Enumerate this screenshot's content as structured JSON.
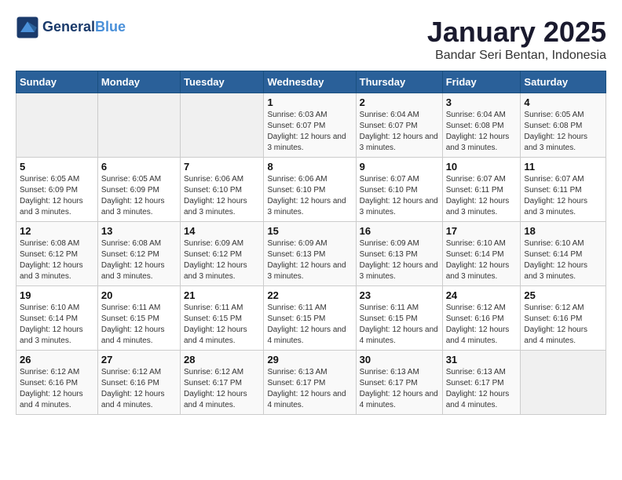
{
  "header": {
    "logo_line1": "General",
    "logo_line2": "Blue",
    "title": "January 2025",
    "subtitle": "Bandar Seri Bentan, Indonesia"
  },
  "weekdays": [
    "Sunday",
    "Monday",
    "Tuesday",
    "Wednesday",
    "Thursday",
    "Friday",
    "Saturday"
  ],
  "weeks": [
    [
      {
        "day": "",
        "empty": true
      },
      {
        "day": "",
        "empty": true
      },
      {
        "day": "",
        "empty": true
      },
      {
        "day": "1",
        "sunrise": "6:03 AM",
        "sunset": "6:07 PM",
        "daylight": "Daylight: 12 hours and 3 minutes."
      },
      {
        "day": "2",
        "sunrise": "6:04 AM",
        "sunset": "6:07 PM",
        "daylight": "Daylight: 12 hours and 3 minutes."
      },
      {
        "day": "3",
        "sunrise": "6:04 AM",
        "sunset": "6:08 PM",
        "daylight": "Daylight: 12 hours and 3 minutes."
      },
      {
        "day": "4",
        "sunrise": "6:05 AM",
        "sunset": "6:08 PM",
        "daylight": "Daylight: 12 hours and 3 minutes."
      }
    ],
    [
      {
        "day": "5",
        "sunrise": "6:05 AM",
        "sunset": "6:09 PM",
        "daylight": "Daylight: 12 hours and 3 minutes."
      },
      {
        "day": "6",
        "sunrise": "6:05 AM",
        "sunset": "6:09 PM",
        "daylight": "Daylight: 12 hours and 3 minutes."
      },
      {
        "day": "7",
        "sunrise": "6:06 AM",
        "sunset": "6:10 PM",
        "daylight": "Daylight: 12 hours and 3 minutes."
      },
      {
        "day": "8",
        "sunrise": "6:06 AM",
        "sunset": "6:10 PM",
        "daylight": "Daylight: 12 hours and 3 minutes."
      },
      {
        "day": "9",
        "sunrise": "6:07 AM",
        "sunset": "6:10 PM",
        "daylight": "Daylight: 12 hours and 3 minutes."
      },
      {
        "day": "10",
        "sunrise": "6:07 AM",
        "sunset": "6:11 PM",
        "daylight": "Daylight: 12 hours and 3 minutes."
      },
      {
        "day": "11",
        "sunrise": "6:07 AM",
        "sunset": "6:11 PM",
        "daylight": "Daylight: 12 hours and 3 minutes."
      }
    ],
    [
      {
        "day": "12",
        "sunrise": "6:08 AM",
        "sunset": "6:12 PM",
        "daylight": "Daylight: 12 hours and 3 minutes."
      },
      {
        "day": "13",
        "sunrise": "6:08 AM",
        "sunset": "6:12 PM",
        "daylight": "Daylight: 12 hours and 3 minutes."
      },
      {
        "day": "14",
        "sunrise": "6:09 AM",
        "sunset": "6:12 PM",
        "daylight": "Daylight: 12 hours and 3 minutes."
      },
      {
        "day": "15",
        "sunrise": "6:09 AM",
        "sunset": "6:13 PM",
        "daylight": "Daylight: 12 hours and 3 minutes."
      },
      {
        "day": "16",
        "sunrise": "6:09 AM",
        "sunset": "6:13 PM",
        "daylight": "Daylight: 12 hours and 3 minutes."
      },
      {
        "day": "17",
        "sunrise": "6:10 AM",
        "sunset": "6:14 PM",
        "daylight": "Daylight: 12 hours and 3 minutes."
      },
      {
        "day": "18",
        "sunrise": "6:10 AM",
        "sunset": "6:14 PM",
        "daylight": "Daylight: 12 hours and 3 minutes."
      }
    ],
    [
      {
        "day": "19",
        "sunrise": "6:10 AM",
        "sunset": "6:14 PM",
        "daylight": "Daylight: 12 hours and 3 minutes."
      },
      {
        "day": "20",
        "sunrise": "6:11 AM",
        "sunset": "6:15 PM",
        "daylight": "Daylight: 12 hours and 4 minutes."
      },
      {
        "day": "21",
        "sunrise": "6:11 AM",
        "sunset": "6:15 PM",
        "daylight": "Daylight: 12 hours and 4 minutes."
      },
      {
        "day": "22",
        "sunrise": "6:11 AM",
        "sunset": "6:15 PM",
        "daylight": "Daylight: 12 hours and 4 minutes."
      },
      {
        "day": "23",
        "sunrise": "6:11 AM",
        "sunset": "6:15 PM",
        "daylight": "Daylight: 12 hours and 4 minutes."
      },
      {
        "day": "24",
        "sunrise": "6:12 AM",
        "sunset": "6:16 PM",
        "daylight": "Daylight: 12 hours and 4 minutes."
      },
      {
        "day": "25",
        "sunrise": "6:12 AM",
        "sunset": "6:16 PM",
        "daylight": "Daylight: 12 hours and 4 minutes."
      }
    ],
    [
      {
        "day": "26",
        "sunrise": "6:12 AM",
        "sunset": "6:16 PM",
        "daylight": "Daylight: 12 hours and 4 minutes."
      },
      {
        "day": "27",
        "sunrise": "6:12 AM",
        "sunset": "6:16 PM",
        "daylight": "Daylight: 12 hours and 4 minutes."
      },
      {
        "day": "28",
        "sunrise": "6:12 AM",
        "sunset": "6:17 PM",
        "daylight": "Daylight: 12 hours and 4 minutes."
      },
      {
        "day": "29",
        "sunrise": "6:13 AM",
        "sunset": "6:17 PM",
        "daylight": "Daylight: 12 hours and 4 minutes."
      },
      {
        "day": "30",
        "sunrise": "6:13 AM",
        "sunset": "6:17 PM",
        "daylight": "Daylight: 12 hours and 4 minutes."
      },
      {
        "day": "31",
        "sunrise": "6:13 AM",
        "sunset": "6:17 PM",
        "daylight": "Daylight: 12 hours and 4 minutes."
      },
      {
        "day": "",
        "empty": true
      }
    ]
  ]
}
